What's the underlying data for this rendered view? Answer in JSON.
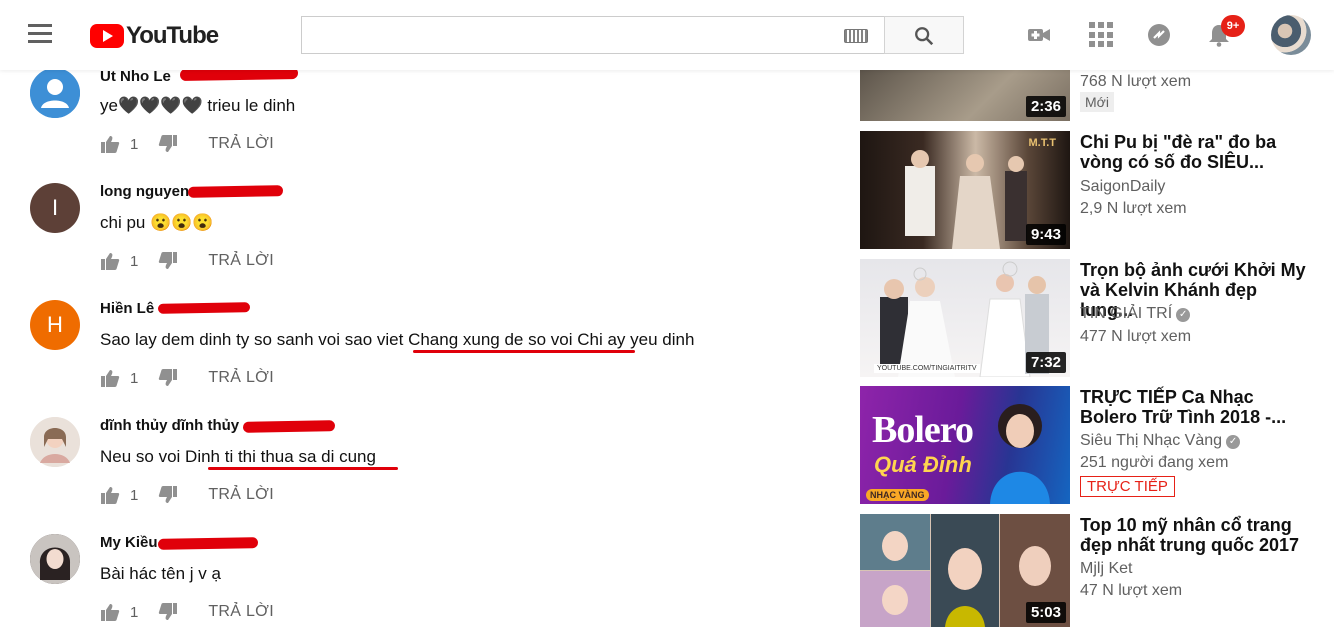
{
  "header": {
    "logo_text": "YouTube",
    "search_value": "",
    "notification_count": "9+"
  },
  "comments": [
    {
      "avatar_letter": "",
      "avatar_color": "#4285f4",
      "author": "Ut Nho Le",
      "text": "ye🖤🖤🖤🖤 trieu le dinh",
      "likes": "1",
      "reply_label": "TRẢ LỜI"
    },
    {
      "avatar_letter": "I",
      "avatar_color": "#5d4037",
      "author": "long nguyen",
      "text": "chi pu 😮😮😮",
      "likes": "1",
      "reply_label": "TRẢ LỜI"
    },
    {
      "avatar_letter": "H",
      "avatar_color": "#ef6c00",
      "author": "Hiền Lê",
      "text_before": "Sao lay dem dinh ty so sanh voi sao viet ",
      "text_underlined": "Chang xung de so voi Chi ay",
      "text_after": " yeu dinh",
      "likes": "1",
      "reply_label": "TRẢ LỜI"
    },
    {
      "avatar_letter": "",
      "avatar_color": "#e8dcd4",
      "author": "dĩnh thủy dĩnh thủy",
      "text_before": "Neu so voi ",
      "text_underlined": "Dinh ti thi thua sa di cung",
      "text_after": "",
      "likes": "1",
      "reply_label": "TRẢ LỜI"
    },
    {
      "avatar_letter": "",
      "avatar_color": "#3b3030",
      "author": "My Kiều",
      "text": "Bài hác tên j v ạ",
      "likes": "1",
      "reply_label": "TRẢ LỜI"
    }
  ],
  "videos": [
    {
      "duration": "2:36",
      "views": "768 N lượt xem",
      "badge": "Mới",
      "thumb_colors": [
        "#6b6257",
        "#b8ad9c"
      ]
    },
    {
      "title": "Chi Pu bị \"đè ra\" đo ba vòng có số đo SIÊU...",
      "channel": "SaigonDaily",
      "views": "2,9 N lượt xem",
      "duration": "9:43",
      "thumb_colors": [
        "#2a1f1a",
        "#c9b8a8"
      ],
      "thumb_text": "M.T.T"
    },
    {
      "title": "Trọn bộ ảnh cưới Khởi My và Kelvin Khánh đẹp lung...",
      "channel": "TIN GIẢI TRÍ",
      "views": "477 N lượt xem",
      "duration": "7:32",
      "thumb_colors": [
        "#d8d8dc",
        "#f4f2f2"
      ],
      "thumb_text": "YOUTUBE.COM/TINGIAITRITV"
    },
    {
      "title": "TRỰC TIẾP Ca Nhạc Bolero Trữ Tình 2018 -...",
      "channel": "Siêu Thị Nhạc Vàng",
      "views": "251 người đang xem",
      "live_label": "TRỰC TIẾP",
      "thumb_title": "Bolero",
      "thumb_subtitle": "Quá Đỉnh",
      "thumb_tag": "NHẠC VÀNG",
      "thumb_colors": [
        "#7b1fa2",
        "#1a237e"
      ]
    },
    {
      "title": "Top 10 mỹ nhân cổ trang đẹp nhất trung quốc 2017",
      "channel": "Mjlj Ket",
      "views": "47 N lượt xem",
      "duration": "5:03",
      "thumb_colors": [
        "#4a6d7c",
        "#d9b8a0"
      ]
    }
  ]
}
